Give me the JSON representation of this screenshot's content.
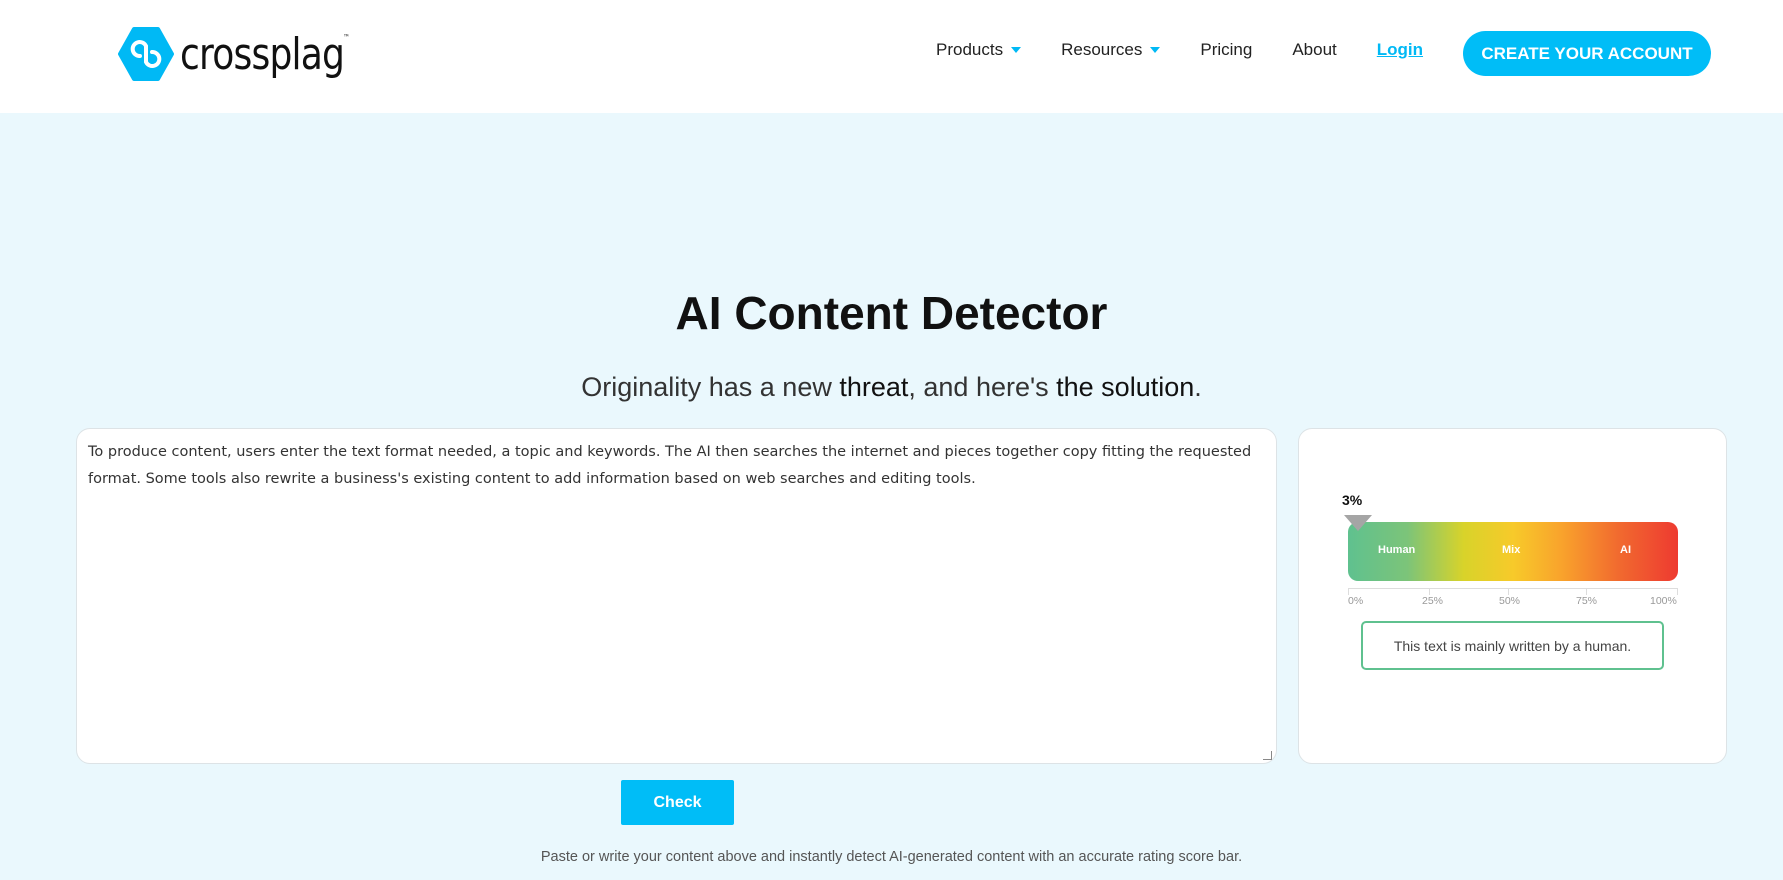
{
  "header": {
    "logo_text": "crossplag",
    "logo_tm": "™",
    "nav": [
      {
        "label": "Products",
        "dropdown": true
      },
      {
        "label": "Resources",
        "dropdown": true
      },
      {
        "label": "Pricing"
      },
      {
        "label": "About"
      }
    ],
    "login": "Login",
    "cta": "CREATE YOUR ACCOUNT"
  },
  "hero": {
    "title": "AI Content Detector",
    "subtitle_parts": [
      "Originality has a new ",
      "threat",
      ", and here's ",
      "the solution",
      "."
    ]
  },
  "input": {
    "value": "To produce content, users enter the text format needed, a topic and keywords. The AI then searches the internet and pieces together copy fitting the requested format. Some tools also rewrite a business's existing content to add information based on web searches and editing tools."
  },
  "result": {
    "score_label": "3%",
    "score_percent": 3,
    "zones": [
      "Human",
      "Mix",
      "AI"
    ],
    "ticks": [
      "0%",
      "25%",
      "50%",
      "75%",
      "100%"
    ],
    "message": "This text is mainly written by a human.",
    "colors": {
      "human": "#5fc18f",
      "mix": "#f7ca2a",
      "ai": "#ee3a30"
    }
  },
  "check_label": "Check",
  "footer_text": "Paste or write your content above and instantly detect AI-generated content with an accurate rating score bar.",
  "accent": "#00bdf7"
}
